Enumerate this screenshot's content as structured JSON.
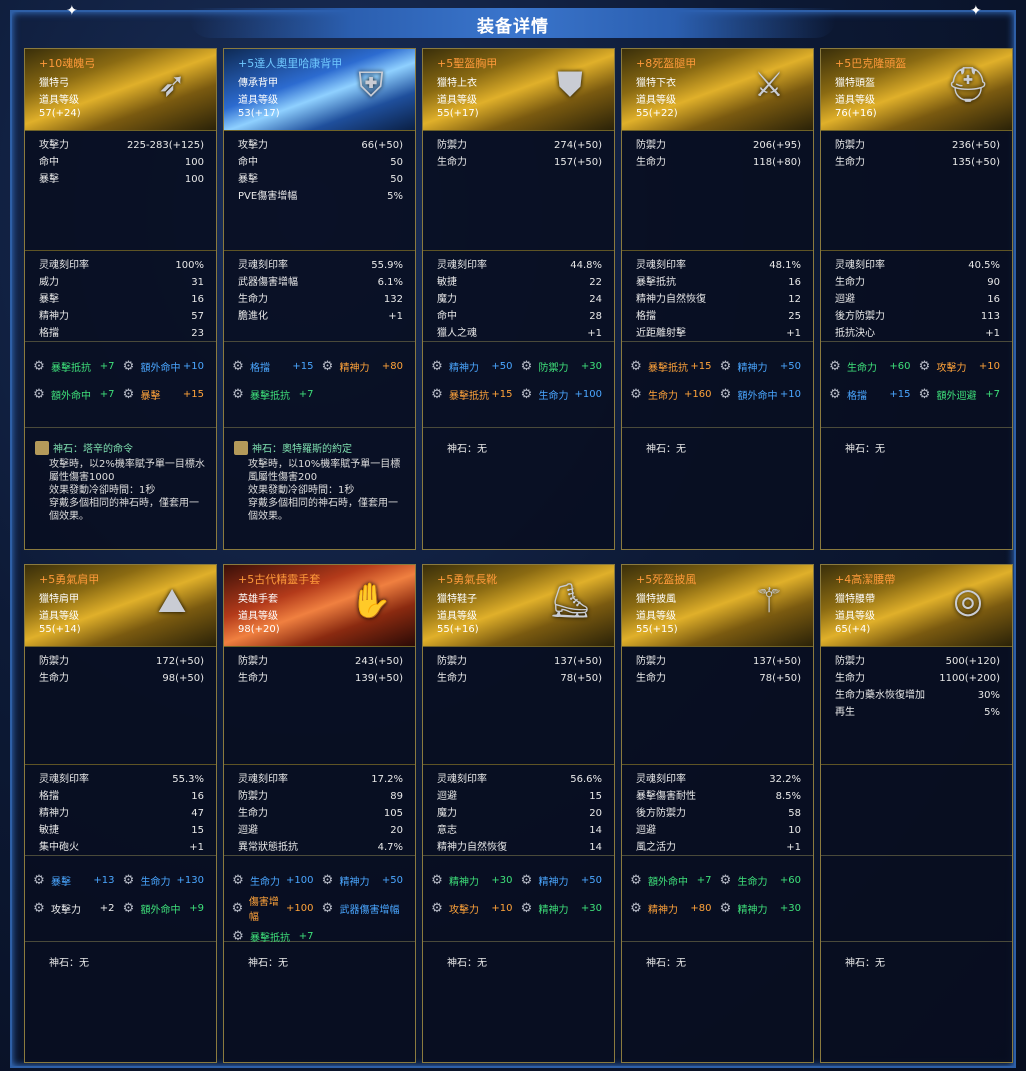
{
  "title": "装备详情",
  "items": [
    {
      "name": "+10魂魄弓",
      "type": "獵特弓",
      "lvl_label": "道具等级",
      "lvl": "57(+24)",
      "icon": "bow-icon",
      "theme": "gold",
      "stats": [
        [
          "攻擊力",
          "225-283(+125)"
        ],
        [
          "命中",
          "100"
        ],
        [
          "暴擊",
          "100"
        ]
      ],
      "sub": [
        [
          "灵魂刻印率",
          "100%"
        ],
        [
          "威力",
          "31"
        ],
        [
          "暴擊",
          "16"
        ],
        [
          "精神力",
          "57"
        ],
        [
          "格擋",
          "23"
        ]
      ],
      "gems": [
        [
          "暴擊抵抗",
          "+7",
          "green"
        ],
        [
          "額外命中",
          "+10",
          "blue"
        ],
        [
          "額外命中",
          "+7",
          "green"
        ],
        [
          "暴擊",
          "+15",
          "orange"
        ]
      ],
      "stone_title": "神石：塔辛的命令",
      "stone_desc": "攻擊時，以2%機率賦予單一目標水\n屬性傷害1000\n效果發動冷卻時間：1秒\n穿戴多個相同的神石時，僅套用一\n個效果。"
    },
    {
      "name": "+5達人奧里哈康背甲",
      "type": "傳承背甲",
      "lvl_label": "道具等级",
      "lvl": "53(+17)",
      "icon": "back-armor-icon",
      "theme": "blue",
      "stats": [
        [
          "攻擊力",
          "66(+50)"
        ],
        [
          "命中",
          "50"
        ],
        [
          "暴擊",
          "50"
        ],
        [
          "PVE傷害增幅",
          "5%"
        ]
      ],
      "sub": [
        [
          "灵魂刻印率",
          "55.9%"
        ],
        [
          "武器傷害增幅",
          "6.1%"
        ],
        [
          "生命力",
          "132"
        ],
        [
          "膽進化",
          "+1"
        ]
      ],
      "gems": [
        [
          "格擋",
          "+15",
          "blue"
        ],
        [
          "精神力",
          "+80",
          "orange"
        ],
        [
          "暴擊抵抗",
          "+7",
          "green"
        ]
      ],
      "stone_title": "神石：奧特羅斯的約定",
      "stone_desc": "攻擊時，以10%機率賦予單一目標\n風屬性傷害200\n效果發動冷卻時間：1秒\n穿戴多個相同的神石時，僅套用一\n個效果。"
    },
    {
      "name": "+5聖盔胸甲",
      "type": "獵特上衣",
      "lvl_label": "道具等级",
      "lvl": "55(+17)",
      "icon": "chest-armor-icon",
      "theme": "gold",
      "stats": [
        [
          "防禦力",
          "274(+50)"
        ],
        [
          "生命力",
          "157(+50)"
        ]
      ],
      "sub": [
        [
          "灵魂刻印率",
          "44.8%"
        ],
        [
          "敏捷",
          "22"
        ],
        [
          "魔力",
          "24"
        ],
        [
          "命中",
          "28"
        ],
        [
          "獵人之魂",
          "+1"
        ]
      ],
      "gems": [
        [
          "精神力",
          "+50",
          "blue"
        ],
        [
          "防禦力",
          "+30",
          "green"
        ],
        [
          "暴擊抵抗",
          "+15",
          "orange"
        ],
        [
          "生命力",
          "+100",
          "blue"
        ]
      ],
      "stone_title": "神石：无",
      "stone_desc": ""
    },
    {
      "name": "+8死盔腿甲",
      "type": "獵特下衣",
      "lvl_label": "道具等级",
      "lvl": "55(+22)",
      "icon": "leg-armor-icon",
      "theme": "gold",
      "stats": [
        [
          "防禦力",
          "206(+95)"
        ],
        [
          "生命力",
          "118(+80)"
        ]
      ],
      "sub": [
        [
          "灵魂刻印率",
          "48.1%"
        ],
        [
          "暴擊抵抗",
          "16"
        ],
        [
          "精神力自然恢復",
          "12"
        ],
        [
          "格擋",
          "25"
        ],
        [
          "近距離射擊",
          "+1"
        ]
      ],
      "gems": [
        [
          "暴擊抵抗",
          "+15",
          "orange"
        ],
        [
          "精神力",
          "+50",
          "blue"
        ],
        [
          "生命力",
          "+160",
          "orange"
        ],
        [
          "額外命中",
          "+10",
          "blue"
        ]
      ],
      "stone_title": "神石：无",
      "stone_desc": ""
    },
    {
      "name": "+5巴克隆頭盔",
      "type": "獵特頭盔",
      "lvl_label": "道具等级",
      "lvl": "76(+16)",
      "icon": "helmet-icon",
      "theme": "gold",
      "stats": [
        [
          "防禦力",
          "236(+50)"
        ],
        [
          "生命力",
          "135(+50)"
        ]
      ],
      "sub": [
        [
          "灵魂刻印率",
          "40.5%"
        ],
        [
          "生命力",
          "90"
        ],
        [
          "迴避",
          "16"
        ],
        [
          "後方防禦力",
          "113"
        ],
        [
          "抵抗決心",
          "+1"
        ]
      ],
      "gems": [
        [
          "生命力",
          "+60",
          "green"
        ],
        [
          "攻擊力",
          "+10",
          "orange"
        ],
        [
          "格擋",
          "+15",
          "blue"
        ],
        [
          "額外迴避",
          "+7",
          "green"
        ]
      ],
      "stone_title": "神石：无",
      "stone_desc": ""
    },
    {
      "name": "+5勇氣肩甲",
      "type": "獵特肩甲",
      "lvl_label": "道具等级",
      "lvl": "55(+14)",
      "icon": "shoulder-armor-icon",
      "theme": "gold",
      "stats": [
        [
          "防禦力",
          "172(+50)"
        ],
        [
          "生命力",
          "98(+50)"
        ]
      ],
      "sub": [
        [
          "灵魂刻印率",
          "55.3%"
        ],
        [
          "格擋",
          "16"
        ],
        [
          "精神力",
          "47"
        ],
        [
          "敏捷",
          "15"
        ],
        [
          "集中砲火",
          "+1"
        ]
      ],
      "gems": [
        [
          "暴擊",
          "+13",
          "blue"
        ],
        [
          "生命力",
          "+130",
          "blue"
        ],
        [
          "攻擊力",
          "+2",
          "white"
        ],
        [
          "額外命中",
          "+9",
          "green"
        ]
      ],
      "stone_title": "神石：无",
      "stone_desc": ""
    },
    {
      "name": "+5古代精靈手套",
      "type": "英雄手套",
      "lvl_label": "道具等级",
      "lvl": "98(+20)",
      "icon": "glove-icon",
      "theme": "red",
      "stats": [
        [
          "防禦力",
          "243(+50)"
        ],
        [
          "生命力",
          "139(+50)"
        ]
      ],
      "sub": [
        [
          "灵魂刻印率",
          "17.2%"
        ],
        [
          "防禦力",
          "89"
        ],
        [
          "生命力",
          "105"
        ],
        [
          "迴避",
          "20"
        ],
        [
          "異常狀態抵抗",
          "4.7%"
        ]
      ],
      "gems": [
        [
          "生命力",
          "+100",
          "blue"
        ],
        [
          "精神力",
          "+50",
          "blue"
        ],
        [
          "傷害增幅",
          "+100",
          "orange"
        ],
        [
          "武器傷害增幅",
          "",
          "blue"
        ],
        [
          "暴擊抵抗",
          "+7",
          "green"
        ]
      ],
      "stone_title": "神石：无",
      "stone_desc": ""
    },
    {
      "name": "+5勇氣長靴",
      "type": "獵特鞋子",
      "lvl_label": "道具等级",
      "lvl": "55(+16)",
      "icon": "boots-icon",
      "theme": "gold",
      "stats": [
        [
          "防禦力",
          "137(+50)"
        ],
        [
          "生命力",
          "78(+50)"
        ]
      ],
      "sub": [
        [
          "灵魂刻印率",
          "56.6%"
        ],
        [
          "迴避",
          "15"
        ],
        [
          "魔力",
          "20"
        ],
        [
          "意志",
          "14"
        ],
        [
          "精神力自然恢復",
          "14"
        ]
      ],
      "gems": [
        [
          "精神力",
          "+30",
          "green"
        ],
        [
          "精神力",
          "+50",
          "blue"
        ],
        [
          "攻擊力",
          "+10",
          "orange"
        ],
        [
          "精神力",
          "+30",
          "green"
        ]
      ],
      "stone_title": "神石：无",
      "stone_desc": ""
    },
    {
      "name": "+5死盔披風",
      "type": "獵特披風",
      "lvl_label": "道具等级",
      "lvl": "55(+15)",
      "icon": "cloak-icon",
      "theme": "gold",
      "stats": [
        [
          "防禦力",
          "137(+50)"
        ],
        [
          "生命力",
          "78(+50)"
        ]
      ],
      "sub": [
        [
          "灵魂刻印率",
          "32.2%"
        ],
        [
          "暴擊傷害耐性",
          "8.5%"
        ],
        [
          "後方防禦力",
          "58"
        ],
        [
          "迴避",
          "10"
        ],
        [
          "風之活力",
          "+1"
        ]
      ],
      "gems": [
        [
          "額外命中",
          "+7",
          "green"
        ],
        [
          "生命力",
          "+60",
          "green"
        ],
        [
          "精神力",
          "+80",
          "orange"
        ],
        [
          "精神力",
          "+30",
          "green"
        ]
      ],
      "stone_title": "神石：无",
      "stone_desc": ""
    },
    {
      "name": "+4高潔腰帶",
      "type": "獵特腰帶",
      "lvl_label": "道具等级",
      "lvl": "65(+4)",
      "icon": "belt-icon",
      "theme": "gold",
      "stats": [
        [
          "防禦力",
          "500(+120)"
        ],
        [
          "生命力",
          "1100(+200)"
        ],
        [
          "生命力藥水恢復增加",
          "30%"
        ],
        [
          "再生",
          "5%"
        ]
      ],
      "sub": [],
      "gems": [],
      "stone_title": "神石：无",
      "stone_desc": ""
    }
  ],
  "colors": {
    "green": "#3ee07a",
    "blue": "#4aa6ff",
    "orange": "#ffa33a",
    "white": "#eeeeee"
  }
}
